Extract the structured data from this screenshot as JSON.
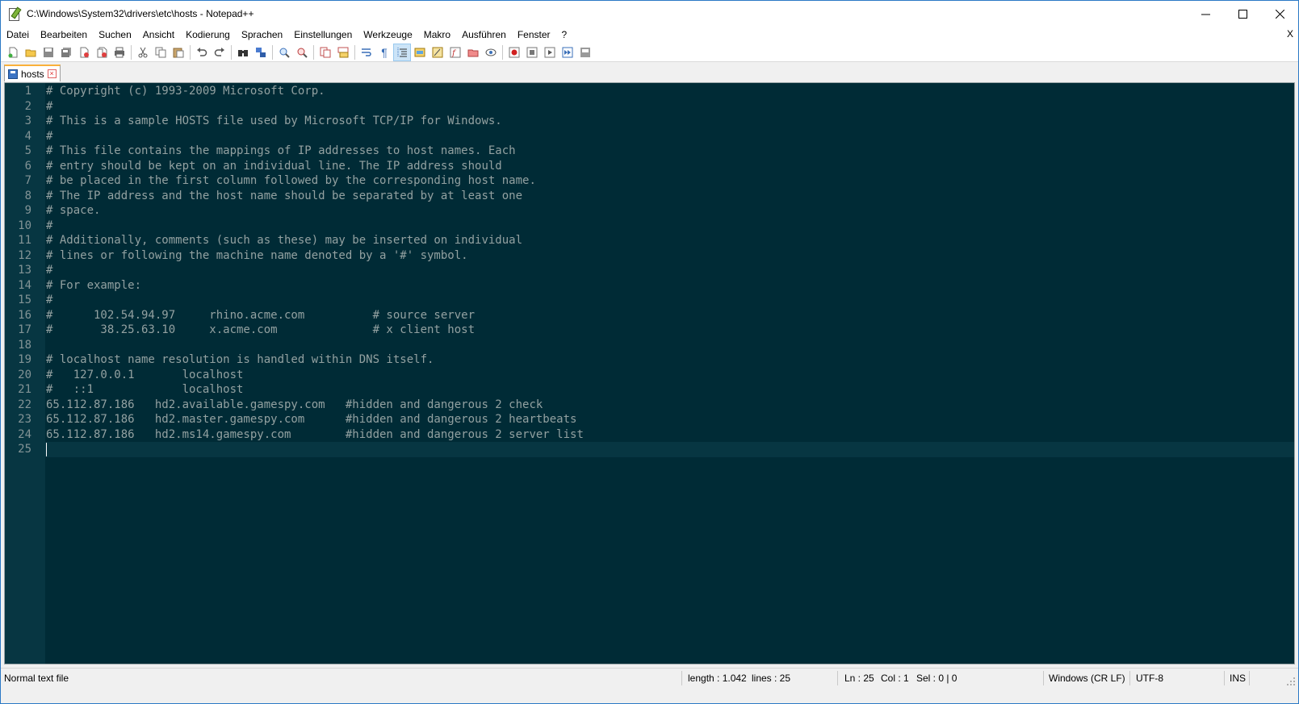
{
  "window": {
    "title": "C:\\Windows\\System32\\drivers\\etc\\hosts - Notepad++",
    "minimize": "—",
    "maximize": "☐",
    "close": "✕"
  },
  "menu": {
    "items": [
      "Datei",
      "Bearbeiten",
      "Suchen",
      "Ansicht",
      "Kodierung",
      "Sprachen",
      "Einstellungen",
      "Werkzeuge",
      "Makro",
      "Ausführen",
      "Fenster",
      "?"
    ],
    "close_doc": "X"
  },
  "toolbar": {
    "buttons": [
      "new-file-icon",
      "open-file-icon",
      "save-icon",
      "save-all-icon",
      "close-icon",
      "close-all-icon",
      "print-icon",
      "cut-icon",
      "copy-icon",
      "paste-icon",
      "undo-icon",
      "redo-icon",
      "find-icon",
      "replace-icon",
      "zoom-in-icon",
      "zoom-out-icon",
      "sync-vertical-icon",
      "sync-horizontal-icon",
      "word-wrap-icon",
      "show-all-chars-icon",
      "indent-guide-icon",
      "language-icon",
      "doc-map-icon",
      "function-list-icon",
      "folder-workspace-icon",
      "monitoring-icon",
      "record-macro-icon",
      "stop-record-icon",
      "play-macro-icon",
      "run-macro-multiple-icon",
      "save-macro-icon"
    ]
  },
  "tab": {
    "label": "hosts",
    "close": "×"
  },
  "editor": {
    "lines": [
      "# Copyright (c) 1993-2009 Microsoft Corp.",
      "#",
      "# This is a sample HOSTS file used by Microsoft TCP/IP for Windows.",
      "#",
      "# This file contains the mappings of IP addresses to host names. Each",
      "# entry should be kept on an individual line. The IP address should",
      "# be placed in the first column followed by the corresponding host name.",
      "# The IP address and the host name should be separated by at least one",
      "# space.",
      "#",
      "# Additionally, comments (such as these) may be inserted on individual",
      "# lines or following the machine name denoted by a '#' symbol.",
      "#",
      "# For example:",
      "#",
      "#      102.54.94.97     rhino.acme.com          # source server",
      "#       38.25.63.10     x.acme.com              # x client host",
      "",
      "# localhost name resolution is handled within DNS itself.",
      "#   127.0.0.1       localhost",
      "#   ::1             localhost",
      "65.112.87.186   hd2.available.gamespy.com   #hidden and dangerous 2 check",
      "65.112.87.186   hd2.master.gamespy.com      #hidden and dangerous 2 heartbeats",
      "65.112.87.186   hd2.ms14.gamespy.com        #hidden and dangerous 2 server list",
      ""
    ],
    "current_line": 25
  },
  "status": {
    "file_type": "Normal text file",
    "length": "length : 1.042",
    "lines": "lines : 25",
    "ln": "Ln : 25",
    "col": "Col : 1",
    "sel": "Sel : 0 | 0",
    "eol": "Windows (CR LF)",
    "encoding": "UTF-8",
    "mode": "INS"
  },
  "colors": {
    "editor_bg": "#002b36",
    "gutter_bg": "#073642",
    "text": "#93a1a1",
    "line_number": "#839496",
    "tab_accent": "#fab03b"
  }
}
